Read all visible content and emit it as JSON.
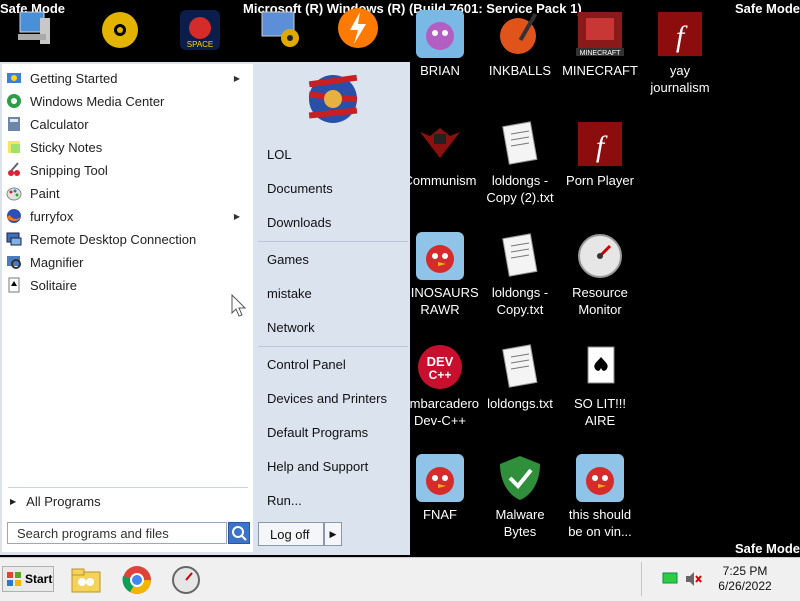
{
  "overlays": {
    "safe_mode": "Safe Mode",
    "title": "Microsoft (R) Windows (R) (Build 7601: Service Pack 1)"
  },
  "desktop_icons": [
    {
      "label": "BRIAN"
    },
    {
      "label": "INKBALLS"
    },
    {
      "label": "MINECRAFT"
    },
    {
      "label": "yay journalism"
    },
    {
      "label": "Communism"
    },
    {
      "label": "loldongs - Copy (2).txt"
    },
    {
      "label": "Porn Player"
    },
    {
      "label": "DINOSAURS RAWR"
    },
    {
      "label": "loldongs - Copy.txt"
    },
    {
      "label": "Resource Monitor"
    },
    {
      "label": "Embarcadero Dev-C++"
    },
    {
      "label": "loldongs.txt"
    },
    {
      "label": "SO LIT!!! AIRE"
    },
    {
      "label": "FNAF"
    },
    {
      "label": "Malware Bytes"
    },
    {
      "label": "this should be on vin..."
    }
  ],
  "start_menu": {
    "programs": [
      {
        "label": "Getting Started",
        "icon": "getting-started-icon",
        "submenu": true
      },
      {
        "label": "Windows Media Center",
        "icon": "media-center-icon",
        "submenu": false
      },
      {
        "label": "Calculator",
        "icon": "calculator-icon",
        "submenu": false
      },
      {
        "label": "Sticky Notes",
        "icon": "sticky-notes-icon",
        "submenu": false
      },
      {
        "label": "Snipping Tool",
        "icon": "snipping-tool-icon",
        "submenu": false
      },
      {
        "label": "Paint",
        "icon": "paint-icon",
        "submenu": false
      },
      {
        "label": "furryfox",
        "icon": "firefox-icon",
        "submenu": true
      },
      {
        "label": "Remote Desktop Connection",
        "icon": "remote-desktop-icon",
        "submenu": false
      },
      {
        "label": "Magnifier",
        "icon": "magnifier-icon",
        "submenu": false
      },
      {
        "label": "Solitaire",
        "icon": "solitaire-icon",
        "submenu": false
      }
    ],
    "all_programs": "All Programs",
    "search_placeholder": "Search programs and files",
    "right_items": [
      "LOL",
      "Documents",
      "Downloads",
      "Games",
      "mistake",
      "Network",
      "Control Panel",
      "Devices and Printers",
      "Default Programs",
      "Help and Support",
      "Run..."
    ],
    "logoff": "Log off"
  },
  "taskbar": {
    "start_label": "Start",
    "time": "7:25 PM",
    "date": "6/26/2022"
  },
  "colors": {
    "desktop": "#000000",
    "start_menu_left": "#ffffff",
    "start_menu_right": "#dbe3ee",
    "taskbar": "#f0f0f0"
  }
}
